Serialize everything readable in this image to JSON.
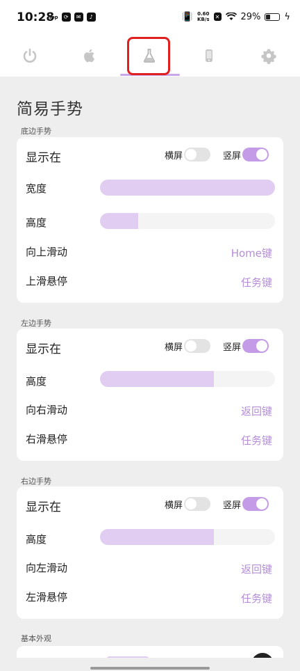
{
  "status_bar": {
    "time": "10:28",
    "top_tag": "Top",
    "net_speed": "0.60",
    "net_unit": "KB/s",
    "battery": "29%"
  },
  "tabs": [
    {
      "name": "power",
      "icon": "power-icon"
    },
    {
      "name": "apple",
      "icon": "apple-icon"
    },
    {
      "name": "lab",
      "icon": "flask-icon",
      "selected": true
    },
    {
      "name": "phone",
      "icon": "phone-icon"
    },
    {
      "name": "settings",
      "icon": "gear-icon"
    }
  ],
  "accent_color": "#c49be6",
  "page_title": "简易手势",
  "sections": {
    "bottom": {
      "label": "底边手势",
      "show_label": "显示在",
      "landscape_label": "横屏",
      "landscape_on": false,
      "portrait_label": "竖屏",
      "portrait_on": true,
      "width_label": "宽度",
      "width_value": 1.0,
      "height_label": "高度",
      "height_value": 0.22,
      "swipe_label": "向上滑动",
      "swipe_value": "Home键",
      "hover_label": "上滑悬停",
      "hover_value": "任务键"
    },
    "left": {
      "label": "左边手势",
      "show_label": "显示在",
      "landscape_label": "横屏",
      "landscape_on": false,
      "portrait_label": "竖屏",
      "portrait_on": true,
      "height_label": "高度",
      "height_value": 0.65,
      "swipe_label": "向右滑动",
      "swipe_value": "返回键",
      "hover_label": "右滑悬停",
      "hover_value": "任务键"
    },
    "right": {
      "label": "右边手势",
      "show_label": "显示在",
      "landscape_label": "横屏",
      "landscape_on": false,
      "portrait_label": "竖屏",
      "portrait_on": true,
      "height_label": "高度",
      "height_value": 0.65,
      "swipe_label": "向左滑动",
      "swipe_value": "返回键",
      "hover_label": "左滑悬停",
      "hover_value": "任务键"
    },
    "appearance": {
      "label": "基本外观"
    }
  }
}
